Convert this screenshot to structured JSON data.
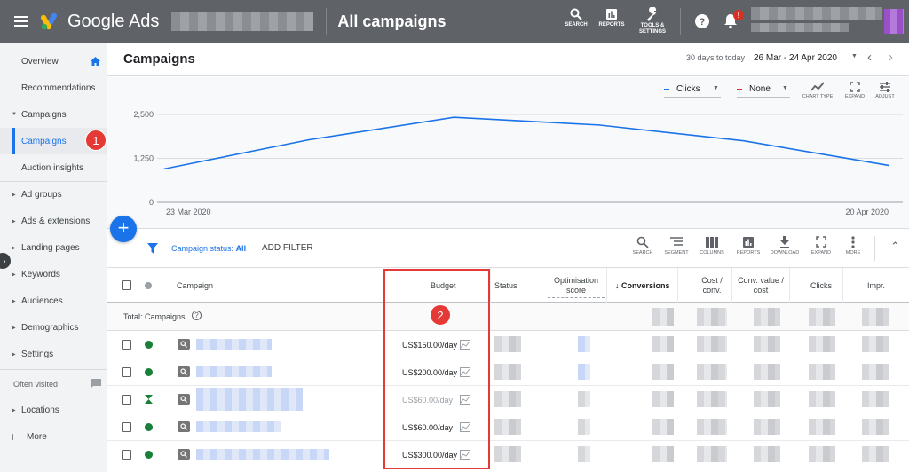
{
  "topbar": {
    "product": "Google Ads",
    "page_title": "All campaigns",
    "tools": [
      {
        "label": "SEARCH",
        "icon": "search-icon"
      },
      {
        "label": "REPORTS",
        "icon": "reports-icon"
      },
      {
        "label": "TOOLS & SETTINGS",
        "icon": "wrench-icon"
      }
    ],
    "notification_count": "!"
  },
  "sidebar": {
    "items": [
      {
        "label": "Overview"
      },
      {
        "label": "Recommendations"
      },
      {
        "label": "Campaigns"
      },
      {
        "label": "Campaigns"
      },
      {
        "label": "Auction insights"
      },
      {
        "label": "Ad groups"
      },
      {
        "label": "Ads & extensions"
      },
      {
        "label": "Landing pages"
      },
      {
        "label": "Keywords"
      },
      {
        "label": "Audiences"
      },
      {
        "label": "Demographics"
      },
      {
        "label": "Settings"
      },
      {
        "label": "Often visited"
      },
      {
        "label": "Locations"
      },
      {
        "label": "More"
      }
    ]
  },
  "annotations": {
    "badge1": "1",
    "badge2": "2"
  },
  "header": {
    "title": "Campaigns",
    "date_prefix": "30 days to today",
    "date_range": "26 Mar - 24 Apr 2020"
  },
  "chart_controls": {
    "metric1": "Clicks",
    "metric2": "None",
    "actions": [
      "CHART TYPE",
      "EXPAND",
      "ADJUST"
    ]
  },
  "chart_data": {
    "type": "line",
    "x": [
      "23 Mar 2020",
      "",
      "",
      "",
      "",
      "20 Apr 2020"
    ],
    "x_tick_labels": [
      "23 Mar 2020",
      "20 Apr 2020"
    ],
    "y_ticks": [
      "0",
      "1,250",
      "2,500"
    ],
    "ylim": [
      0,
      2500
    ],
    "series": [
      {
        "values": [
          950,
          1780,
          2420,
          2200,
          1750,
          1050
        ],
        "color": "#1a73e8"
      }
    ],
    "grid": true
  },
  "filter": {
    "status_label": "Campaign status:",
    "status_value": "All",
    "add_filter": "ADD FILTER",
    "tools": [
      "SEARCH",
      "SEGMENT",
      "COLUMNS",
      "REPORTS",
      "DOWNLOAD",
      "EXPAND",
      "MORE"
    ]
  },
  "table": {
    "headers": {
      "campaign": "Campaign",
      "budget": "Budget",
      "status": "Status",
      "opt_score": "Optimisation score",
      "conversions": "Conversions",
      "cost_conv": "Cost / conv.",
      "conv_value": "Conv. value / cost",
      "clicks": "Clicks",
      "impr": "Impr."
    },
    "total_label": "Total: Campaigns",
    "rows": [
      {
        "status": "enabled",
        "budget": "US$150.00/day"
      },
      {
        "status": "enabled",
        "budget": "US$200.00/day"
      },
      {
        "status": "pending",
        "budget": "US$60.00/day"
      },
      {
        "status": "enabled",
        "budget": "US$60.00/day"
      },
      {
        "status": "enabled",
        "budget": "US$300.00/day"
      }
    ]
  },
  "colors": {
    "accent": "#1a73e8",
    "green": "#188038",
    "red": "#e53935",
    "topbar": "#5f6368"
  }
}
